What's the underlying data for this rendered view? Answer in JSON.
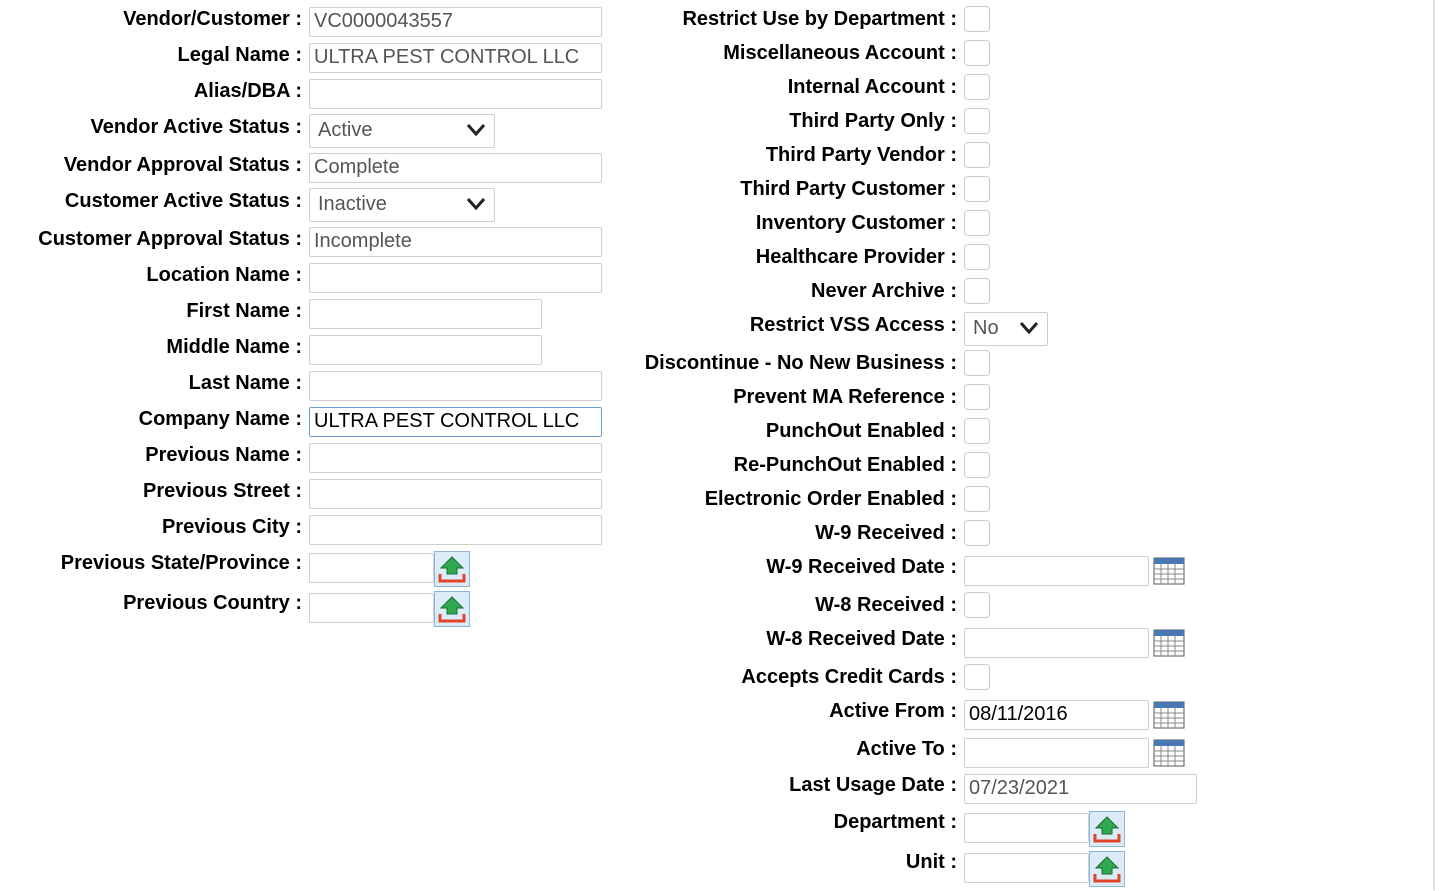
{
  "left": {
    "vendor_customer": {
      "label": "Vendor/Customer :",
      "value": "VC0000043557"
    },
    "legal_name": {
      "label": "Legal Name :",
      "value": "ULTRA PEST CONTROL LLC"
    },
    "alias_dba": {
      "label": "Alias/DBA :",
      "value": ""
    },
    "vendor_active_status": {
      "label": "Vendor Active Status :",
      "value": "Active"
    },
    "vendor_approval_status": {
      "label": "Vendor Approval Status :",
      "value": "Complete"
    },
    "customer_active_status": {
      "label": "Customer Active Status :",
      "value": "Inactive"
    },
    "customer_approval_status": {
      "label": "Customer Approval Status :",
      "value": "Incomplete"
    },
    "location_name": {
      "label": "Location Name :",
      "value": ""
    },
    "first_name": {
      "label": "First Name :",
      "value": ""
    },
    "middle_name": {
      "label": "Middle Name :",
      "value": ""
    },
    "last_name": {
      "label": "Last Name :",
      "value": ""
    },
    "company_name": {
      "label": "Company Name :",
      "value": "ULTRA PEST CONTROL LLC"
    },
    "previous_name": {
      "label": "Previous Name :",
      "value": ""
    },
    "previous_street": {
      "label": "Previous Street :",
      "value": ""
    },
    "previous_city": {
      "label": "Previous City :",
      "value": ""
    },
    "previous_state": {
      "label": "Previous State/Province :",
      "value": ""
    },
    "previous_country": {
      "label": "Previous Country :",
      "value": ""
    }
  },
  "right": {
    "restrict_use_by_department": {
      "label": "Restrict Use by Department :",
      "checked": false
    },
    "miscellaneous_account": {
      "label": "Miscellaneous Account :",
      "checked": false
    },
    "internal_account": {
      "label": "Internal Account :",
      "checked": false
    },
    "third_party_only": {
      "label": "Third Party Only :",
      "checked": false
    },
    "third_party_vendor": {
      "label": "Third Party Vendor :",
      "checked": false
    },
    "third_party_customer": {
      "label": "Third Party Customer :",
      "checked": false
    },
    "inventory_customer": {
      "label": "Inventory Customer :",
      "checked": false
    },
    "healthcare_provider": {
      "label": "Healthcare Provider :",
      "checked": false
    },
    "never_archive": {
      "label": "Never Archive :",
      "checked": false
    },
    "restrict_vss_access": {
      "label": "Restrict VSS Access :",
      "value": "No"
    },
    "discontinue": {
      "label": "Discontinue - No New Business :",
      "checked": false
    },
    "prevent_ma_reference": {
      "label": "Prevent MA Reference :",
      "checked": false
    },
    "punchout_enabled": {
      "label": "PunchOut Enabled :",
      "checked": false
    },
    "re_punchout_enabled": {
      "label": "Re-PunchOut Enabled :",
      "checked": false
    },
    "electronic_order_enabled": {
      "label": "Electronic Order Enabled :",
      "checked": false
    },
    "w9_received": {
      "label": "W-9 Received :",
      "checked": false
    },
    "w9_received_date": {
      "label": "W-9 Received Date :",
      "value": ""
    },
    "w8_received": {
      "label": "W-8 Received :",
      "checked": false
    },
    "w8_received_date": {
      "label": "W-8 Received Date :",
      "value": ""
    },
    "accepts_credit_cards": {
      "label": "Accepts Credit Cards :",
      "checked": false
    },
    "active_from": {
      "label": "Active From :",
      "value": "08/11/2016"
    },
    "active_to": {
      "label": "Active To :",
      "value": ""
    },
    "last_usage_date": {
      "label": "Last Usage Date :",
      "value": "07/23/2021"
    },
    "department": {
      "label": "Department :",
      "value": ""
    },
    "unit": {
      "label": "Unit :",
      "value": ""
    }
  },
  "icons": {
    "chevron": "chevron-down-icon",
    "lookup": "lookup-arrow-icon",
    "calendar": "calendar-icon"
  },
  "colors": {
    "lookup_green": "#2fa84f",
    "lookup_red": "#e0452a",
    "focus_border": "#6a9fd4"
  }
}
